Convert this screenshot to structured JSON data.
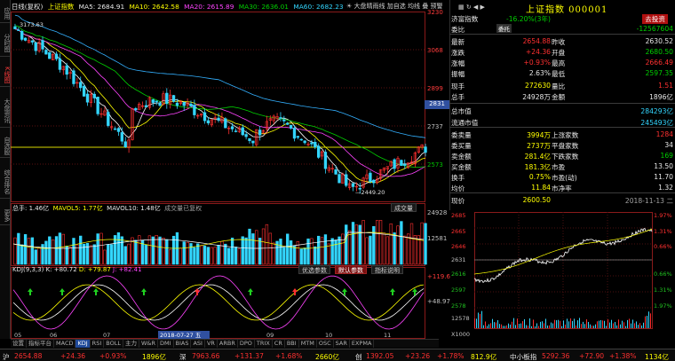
{
  "left_toolbar": {
    "items": [
      "应用",
      "分时图",
      "K线图",
      "大盘资讯",
      "自选股",
      "综合排名",
      "更多"
    ],
    "active_index": 2
  },
  "chart_header": {
    "period": "日线(复权)",
    "index_name": "上证指数",
    "ma5": "MA5: 2684.91",
    "ma10": "MA10: 2642.58",
    "ma20": "MA20: 2615.89",
    "ma30": "MA30: 2636.01",
    "ma60": "MA60: 2682.23",
    "flag": "大盘晴雨线",
    "add_self": "加自选",
    "ma_label": "均线",
    "superpose": "叠",
    "warn": "预警"
  },
  "price_axis": {
    "labels": [
      "3230",
      "3068",
      "2899",
      "2831",
      "2737",
      "2573"
    ],
    "highlight_price": "2831",
    "high_label": "3173.63",
    "low_label": "2449.20"
  },
  "volume_header": {
    "total": "总手: 1.46亿",
    "mavol5": "MAVOL5: 1.77亿",
    "mavol10": "MAVOL10: 1.48亿",
    "note": "成交量已复权",
    "button": "成交量",
    "axis_top": "24928",
    "axis_mid": "12581"
  },
  "kdj_header": {
    "title": "KDJ(9,3,3)",
    "k": "K: +80.72",
    "d": "D: +79.87",
    "j": "J: +82.41",
    "btn_optimize": "优选参数",
    "btn_default": "默认参数",
    "btn_help": "指标说明",
    "axis_top": "+119.6",
    "axis_mid": "+48.97"
  },
  "x_axis": {
    "labels": [
      "05",
      "06",
      "07",
      "2018-07-27 五",
      "09",
      "10",
      "11"
    ]
  },
  "right_panel": {
    "title": "上证指数 000001",
    "toolbar": "综宝 ⊙ ◀ ▶",
    "entrust_label": "委托",
    "rows": [
      {
        "l1": "济富指数",
        "v1": "-16.20%(3年)",
        "l2": "",
        "v2": "去投资",
        "c1": "c-green",
        "c2": "btn"
      },
      {
        "l1": "委比",
        "v1": "",
        "l2": "",
        "v2": "-12567604",
        "c1": "c-green",
        "c2": "c-green"
      },
      {
        "l1": "最新",
        "v1": "2654.88",
        "l2": "昨收",
        "v2": "2630.52",
        "c1": "c-red",
        "c2": "c-white"
      },
      {
        "l1": "涨跌",
        "v1": "+24.36",
        "l2": "开盘",
        "v2": "2680.50",
        "c1": "c-red",
        "c2": "c-green"
      },
      {
        "l1": "涨幅",
        "v1": "+0.93%",
        "l2": "最高",
        "v2": "2666.49",
        "c1": "c-red",
        "c2": "c-red"
      },
      {
        "l1": "振幅",
        "v1": "2.63%",
        "l2": "最低",
        "v2": "2597.35",
        "c1": "c-white",
        "c2": "c-green"
      },
      {
        "l1": "现手",
        "v1": "272630",
        "l2": "量比",
        "v2": "1.51",
        "c1": "c-yellow",
        "c2": "c-red"
      },
      {
        "l1": "总手",
        "v1": "24928万",
        "l2": "金额",
        "v2": "1896亿",
        "c1": "c-white",
        "c2": "c-white"
      },
      {
        "l1": "总市值",
        "v1": "",
        "l2": "",
        "v2": "284293亿",
        "c1": "c-white",
        "c2": "c-cyan"
      },
      {
        "l1": "流通市值",
        "v1": "",
        "l2": "",
        "v2": "245493亿",
        "c1": "c-white",
        "c2": "c-cyan"
      },
      {
        "l1": "委卖量",
        "v1": "3994万",
        "l2": "上涨家数",
        "v2": "1284",
        "c1": "c-yellow",
        "c2": "c-red"
      },
      {
        "l1": "委买量",
        "v1": "2737万",
        "l2": "平盘家数",
        "v2": "34",
        "c1": "c-yellow",
        "c2": "c-white"
      },
      {
        "l1": "卖金额",
        "v1": "281.4亿",
        "l2": "下跌家数",
        "v2": "169",
        "c1": "c-yellow",
        "c2": "c-green"
      },
      {
        "l1": "买金额",
        "v1": "181.3亿",
        "l2": "市盈",
        "v2": "13.50",
        "c1": "c-yellow",
        "c2": "c-white"
      },
      {
        "l1": "换手",
        "v1": "0.75%",
        "l2": "市盈(动)",
        "v2": "11.70",
        "c1": "c-yellow",
        "c2": "c-white"
      },
      {
        "l1": "均价",
        "v1": "11.84",
        "l2": "市净率",
        "v2": "1.32",
        "c1": "c-yellow",
        "c2": "c-white"
      },
      {
        "l1": "现价",
        "v1": "2600.50",
        "l2": "",
        "v2": "2018-11-13 二",
        "c1": "c-yellow",
        "c2": "c-gray"
      }
    ]
  },
  "intraday": {
    "left_labels": [
      "2685",
      "2665",
      "2646",
      "2631",
      "2616",
      "2597",
      "2578",
      "12578",
      "X1000"
    ],
    "right_labels": [
      "1.97%",
      "1.31%",
      "0.66%",
      "0.66%",
      "1.31%",
      "1.97%"
    ]
  },
  "bottom_tabs": {
    "items": [
      "设置",
      "指标平台",
      "MACD",
      "KDJ",
      "RSI",
      "BOLL",
      "主力",
      "W&R",
      "DMI",
      "BIAS",
      "ASI",
      "VR",
      "ARBR",
      "DPO",
      "TRIX",
      "CR",
      "BBI",
      "MTM",
      "OSC",
      "SAR",
      "EXPMA"
    ],
    "selected_index": 3
  },
  "status_bar": {
    "sh_label": "沪",
    "sh_price": "2654.88",
    "sh_change": "+24.36",
    "sh_pct": "+0.93%",
    "sh_amount": "1896亿",
    "sz_label": "深",
    "sz_price": "7963.66",
    "sz_change": "+131.37",
    "sz_pct": "+1.68%",
    "sz_amount": "2660亿",
    "cy_label": "创",
    "cy_price": "1392.05",
    "cy_change": "+23.26",
    "cy_pct": "+1.78%",
    "cy_amount": "812.9亿",
    "sme_label": "中小板指",
    "sme_price": "5292.36",
    "sme_change": "+72.90",
    "sme_pct": "+1.38%",
    "sme_amount": "1134亿"
  },
  "colors": {
    "up": "#ff3030",
    "down": "#33d6ff",
    "ma5": "#ffffff",
    "ma10": "#ffff00",
    "ma20": "#ff44ff",
    "ma30": "#00d000",
    "ma60": "#33b0ff"
  }
}
